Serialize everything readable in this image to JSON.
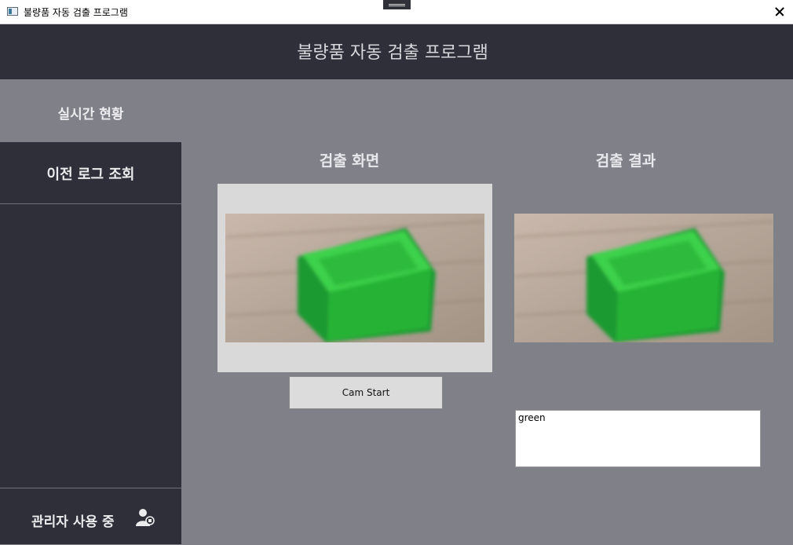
{
  "window": {
    "title": "불량품 자동 검출 프로그램",
    "icon": "app-window-icon",
    "close_icon": "close-icon"
  },
  "header": {
    "title": "불량품 자동 검출 프로그램"
  },
  "sidebar": {
    "realtime_label": "실시간 현황",
    "log_label": "이전 로그 조회",
    "admin_label": "관리자 사용 중",
    "admin_icon": "admin-user-icon"
  },
  "detection": {
    "title": "검출 화면",
    "cam_button": "Cam Start"
  },
  "result": {
    "title": "검출 결과",
    "text": "green"
  },
  "colors": {
    "header_bg": "#2e2f39",
    "content_bg": "#808089",
    "object": "#2fbf3f"
  }
}
